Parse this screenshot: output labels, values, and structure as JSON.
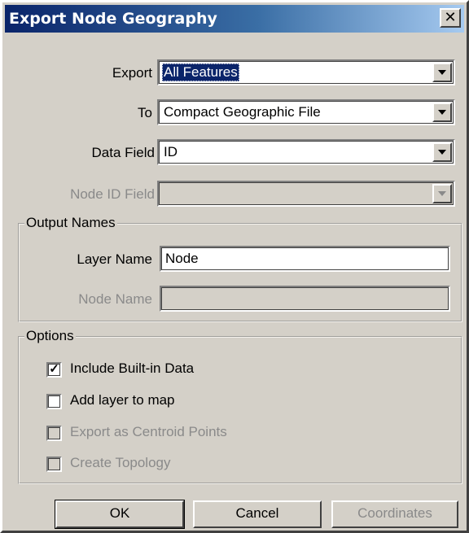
{
  "window": {
    "title": "Export Node Geography",
    "close_glyph": "✕"
  },
  "fields": {
    "export": {
      "label": "Export",
      "value": "All Features"
    },
    "to": {
      "label": "To",
      "value": "Compact Geographic File"
    },
    "data_field": {
      "label": "Data Field",
      "value": "ID"
    },
    "node_id_field": {
      "label": "Node ID Field",
      "value": ""
    }
  },
  "output_names": {
    "title": "Output Names",
    "layer_name": {
      "label": "Layer Name",
      "value": "Node"
    },
    "node_name": {
      "label": "Node Name",
      "value": ""
    }
  },
  "options": {
    "title": "Options",
    "include_builtin": {
      "label": "Include Built-in Data",
      "checked": true,
      "mark": "✓"
    },
    "add_layer": {
      "label": "Add layer to map",
      "checked": false,
      "mark": ""
    },
    "export_centroid": {
      "label": "Export as Centroid Points",
      "checked": false,
      "mark": ""
    },
    "create_topology": {
      "label": "Create Topology",
      "checked": false,
      "mark": ""
    }
  },
  "buttons": {
    "ok": "OK",
    "cancel": "Cancel",
    "coordinates": "Coordinates"
  }
}
